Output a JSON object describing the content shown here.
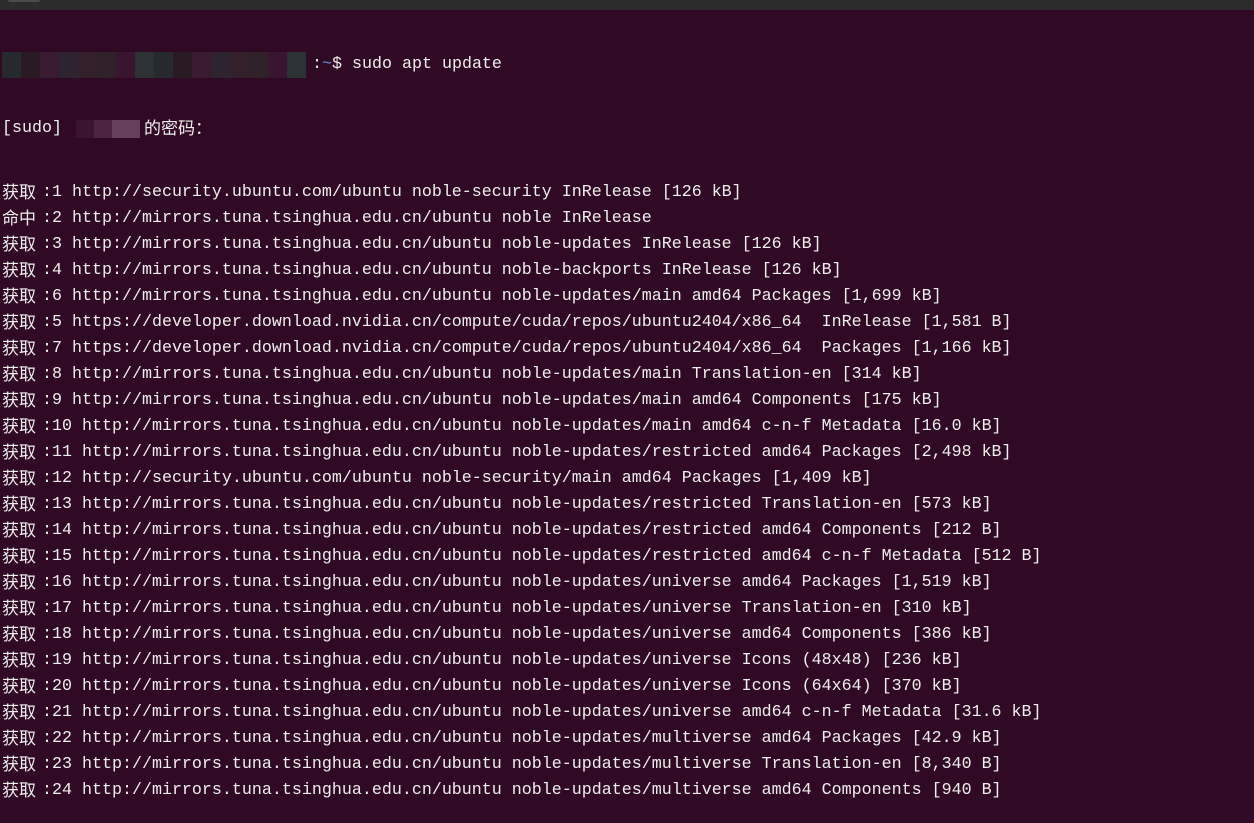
{
  "prompt": {
    "separator": ":",
    "tilde": "~",
    "symbol": "$",
    "command": " sudo apt update"
  },
  "sudo_prompt": {
    "prefix": "[sudo] ",
    "suffix": "的密码："
  },
  "lines": [
    {
      "label": "获取",
      "text": ":1 http://security.ubuntu.com/ubuntu noble-security InRelease [126 kB]"
    },
    {
      "label": "命中",
      "text": ":2 http://mirrors.tuna.tsinghua.edu.cn/ubuntu noble InRelease"
    },
    {
      "label": "获取",
      "text": ":3 http://mirrors.tuna.tsinghua.edu.cn/ubuntu noble-updates InRelease [126 kB]"
    },
    {
      "label": "获取",
      "text": ":4 http://mirrors.tuna.tsinghua.edu.cn/ubuntu noble-backports InRelease [126 kB]"
    },
    {
      "label": "获取",
      "text": ":6 http://mirrors.tuna.tsinghua.edu.cn/ubuntu noble-updates/main amd64 Packages [1,699 kB]"
    },
    {
      "label": "获取",
      "text": ":5 https://developer.download.nvidia.cn/compute/cuda/repos/ubuntu2404/x86_64  InRelease [1,581 B]"
    },
    {
      "label": "获取",
      "text": ":7 https://developer.download.nvidia.cn/compute/cuda/repos/ubuntu2404/x86_64  Packages [1,166 kB]"
    },
    {
      "label": "获取",
      "text": ":8 http://mirrors.tuna.tsinghua.edu.cn/ubuntu noble-updates/main Translation-en [314 kB]"
    },
    {
      "label": "获取",
      "text": ":9 http://mirrors.tuna.tsinghua.edu.cn/ubuntu noble-updates/main amd64 Components [175 kB]"
    },
    {
      "label": "获取",
      "text": ":10 http://mirrors.tuna.tsinghua.edu.cn/ubuntu noble-updates/main amd64 c-n-f Metadata [16.0 kB]"
    },
    {
      "label": "获取",
      "text": ":11 http://mirrors.tuna.tsinghua.edu.cn/ubuntu noble-updates/restricted amd64 Packages [2,498 kB]"
    },
    {
      "label": "获取",
      "text": ":12 http://security.ubuntu.com/ubuntu noble-security/main amd64 Packages [1,409 kB]"
    },
    {
      "label": "获取",
      "text": ":13 http://mirrors.tuna.tsinghua.edu.cn/ubuntu noble-updates/restricted Translation-en [573 kB]"
    },
    {
      "label": "获取",
      "text": ":14 http://mirrors.tuna.tsinghua.edu.cn/ubuntu noble-updates/restricted amd64 Components [212 B]"
    },
    {
      "label": "获取",
      "text": ":15 http://mirrors.tuna.tsinghua.edu.cn/ubuntu noble-updates/restricted amd64 c-n-f Metadata [512 B]"
    },
    {
      "label": "获取",
      "text": ":16 http://mirrors.tuna.tsinghua.edu.cn/ubuntu noble-updates/universe amd64 Packages [1,519 kB]"
    },
    {
      "label": "获取",
      "text": ":17 http://mirrors.tuna.tsinghua.edu.cn/ubuntu noble-updates/universe Translation-en [310 kB]"
    },
    {
      "label": "获取",
      "text": ":18 http://mirrors.tuna.tsinghua.edu.cn/ubuntu noble-updates/universe amd64 Components [386 kB]"
    },
    {
      "label": "获取",
      "text": ":19 http://mirrors.tuna.tsinghua.edu.cn/ubuntu noble-updates/universe Icons (48x48) [236 kB]"
    },
    {
      "label": "获取",
      "text": ":20 http://mirrors.tuna.tsinghua.edu.cn/ubuntu noble-updates/universe Icons (64x64) [370 kB]"
    },
    {
      "label": "获取",
      "text": ":21 http://mirrors.tuna.tsinghua.edu.cn/ubuntu noble-updates/universe amd64 c-n-f Metadata [31.6 kB]"
    },
    {
      "label": "获取",
      "text": ":22 http://mirrors.tuna.tsinghua.edu.cn/ubuntu noble-updates/multiverse amd64 Packages [42.9 kB]"
    },
    {
      "label": "获取",
      "text": ":23 http://mirrors.tuna.tsinghua.edu.cn/ubuntu noble-updates/multiverse Translation-en [8,340 B]"
    },
    {
      "label": "获取",
      "text": ":24 http://mirrors.tuna.tsinghua.edu.cn/ubuntu noble-updates/multiverse amd64 Components [940 B]"
    }
  ]
}
